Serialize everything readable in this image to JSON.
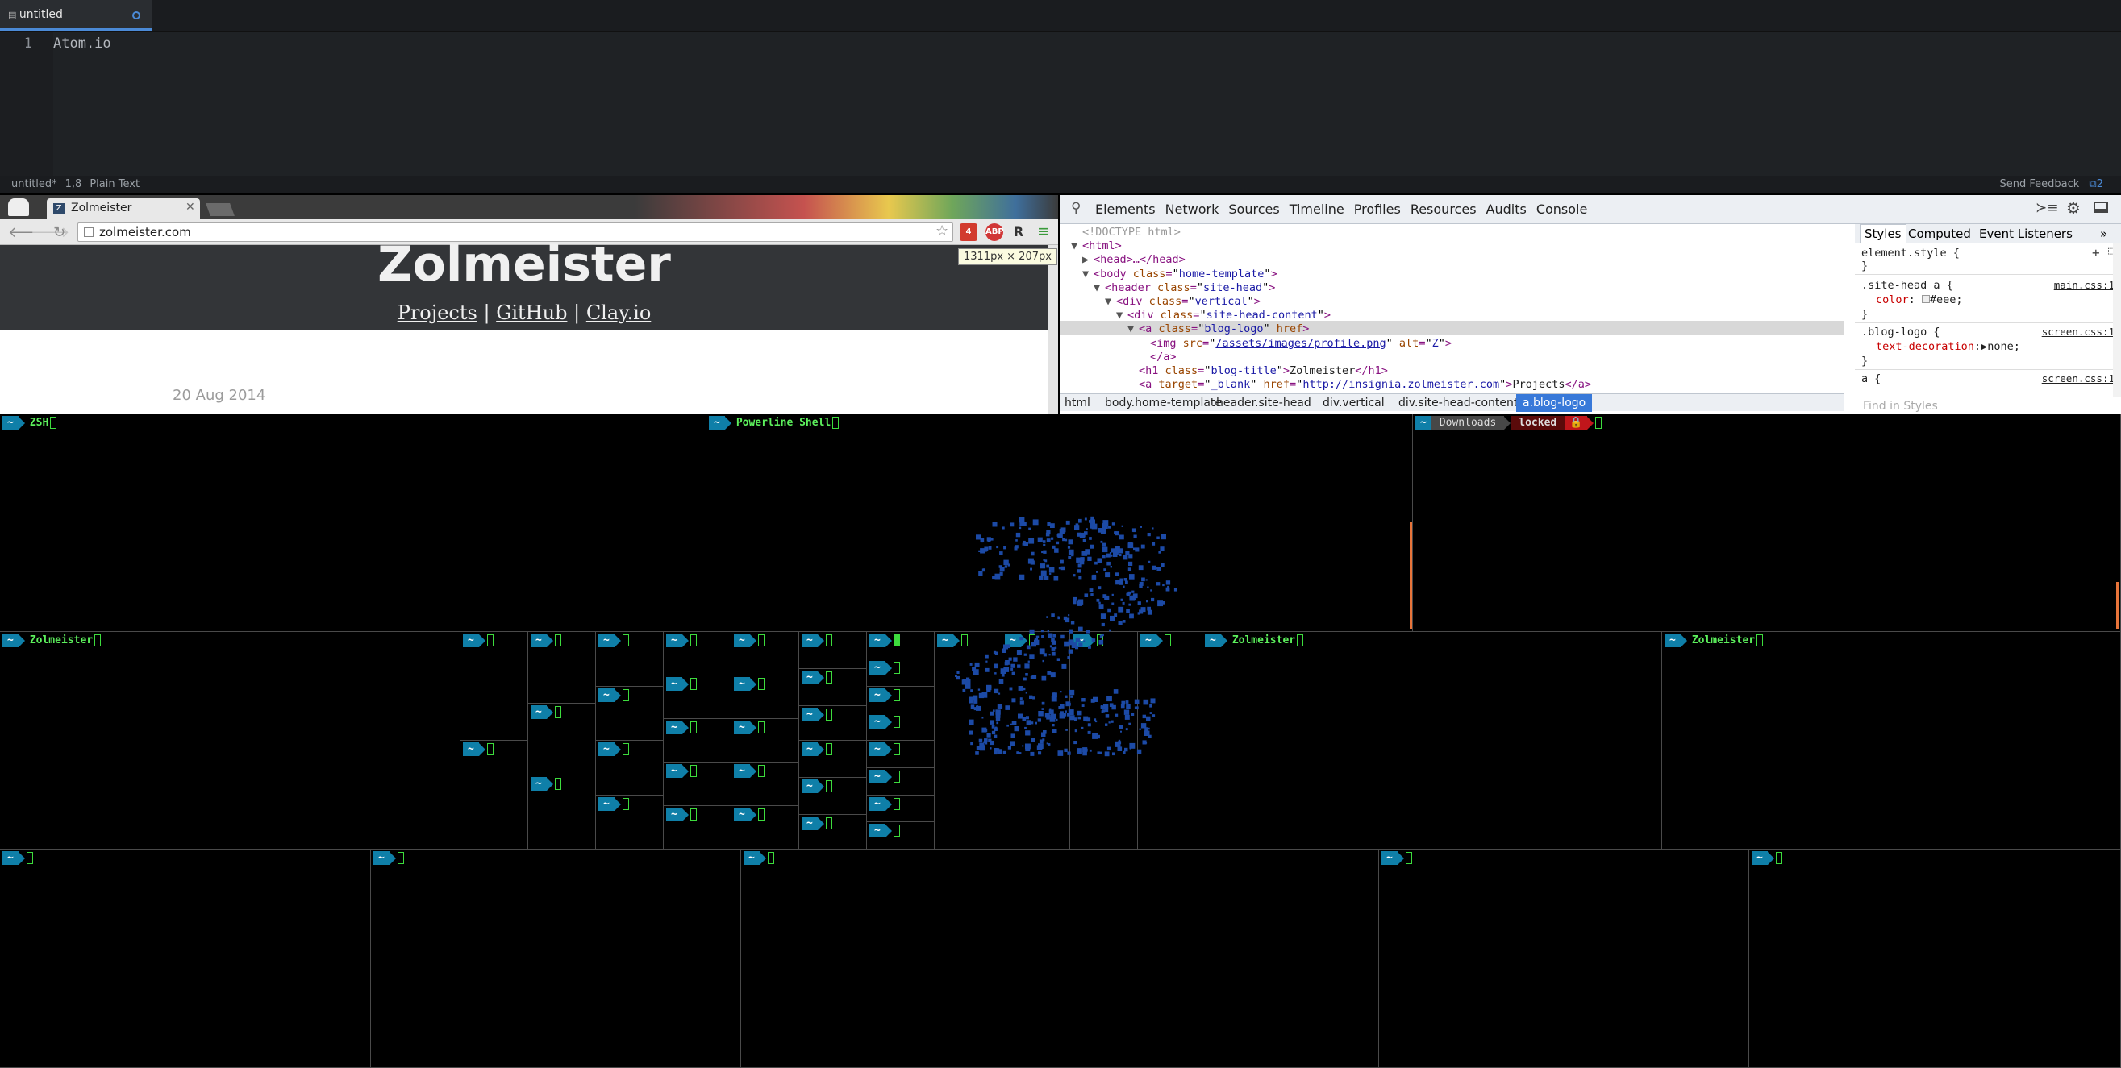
{
  "atom": {
    "tab_icon": "file-icon",
    "tab_title": "untitled",
    "line_number": "1",
    "code_text": "Atom.io",
    "status_file": "untitled*",
    "status_pos": "1,8",
    "status_grammar": "Plain Text",
    "feedback": "Send Feedback",
    "update_count": "2"
  },
  "chrome": {
    "tab_title": "Zolmeister",
    "favicon_letter": "Z",
    "url": "zolmeister.com",
    "ext_gmail_count": "4",
    "ext_abp": "ABP",
    "ext_r": "R",
    "site_title": "Zolmeister",
    "link_projects": "Projects",
    "sep1": "|",
    "link_github": "GitHub",
    "sep2": "|",
    "link_clay": "Clay.io",
    "post_date": "20 Aug 2014",
    "element_dims": "1311px × 207px"
  },
  "devtools": {
    "tabs": [
      "Elements",
      "Network",
      "Sources",
      "Timeline",
      "Profiles",
      "Resources",
      "Audits",
      "Console"
    ],
    "dom_lines": [
      {
        "ind": 1,
        "tri": "",
        "cm": "<!DOCTYPE html>"
      },
      {
        "ind": 1,
        "tri": "▼",
        "open": "html"
      },
      {
        "ind": 2,
        "tri": "▶",
        "open": "head",
        "tail": "…</head>"
      },
      {
        "ind": 2,
        "tri": "▼",
        "open": "body",
        "an": "class",
        "av": "home-template"
      },
      {
        "ind": 3,
        "tri": "▼",
        "open": "header",
        "an": "class",
        "av": "site-head"
      },
      {
        "ind": 4,
        "tri": "▼",
        "open": "div",
        "an": "class",
        "av": "vertical"
      },
      {
        "ind": 5,
        "tri": "▼",
        "open": "div",
        "an": "class",
        "av": "site-head-content"
      },
      {
        "ind": 6,
        "tri": "▼",
        "open": "a",
        "an": "class",
        "av": "blog-logo",
        "an2": "href"
      },
      {
        "ind": 7,
        "tri": "",
        "open": "img",
        "an": "src",
        "av": "/assets/images/profile.png",
        "an2": "alt",
        "av2": "Z",
        "link": true
      },
      {
        "ind": 7,
        "tri": "",
        "close": "a"
      },
      {
        "ind": 6,
        "tri": "",
        "open": "h1",
        "an": "class",
        "av": "blog-title",
        "text": "Zolmeister",
        "close": "h1"
      },
      {
        "ind": 6,
        "tri": "",
        "open": "a",
        "an": "target",
        "av": "_blank",
        "an2": "href",
        "av2": "http://insignia.zolmeister.com",
        "text": "Projects",
        "close": "a"
      }
    ],
    "breadcrumbs": [
      "html",
      "body.home-template",
      "header.site-head",
      "div.vertical",
      "div.site-head-content",
      "a.blog-logo"
    ],
    "styles_tabs": [
      "Styles",
      "Computed",
      "Event Listeners"
    ],
    "more": "»",
    "rules": {
      "element_style": "element.style {",
      "close": "}",
      "r1_sel": ".site-head a {",
      "r1_src": "main.css:1",
      "r1_prop": "color",
      "r1_val": "#eee;",
      "r2_sel": ".blog-logo {",
      "r2_src": "screen.css:1",
      "r2_prop": "text-decoration",
      "r2_val": "none;",
      "r3_sel": "a {",
      "r3_src": "screen.css:1"
    },
    "find_placeholder": "Find in Styles"
  },
  "terminals": {
    "tilde": "~",
    "zsh": "ZSH",
    "powerline": "Powerline Shell",
    "downloads": "Downloads",
    "locked": "locked",
    "zolmeister": "Zolmeister"
  }
}
